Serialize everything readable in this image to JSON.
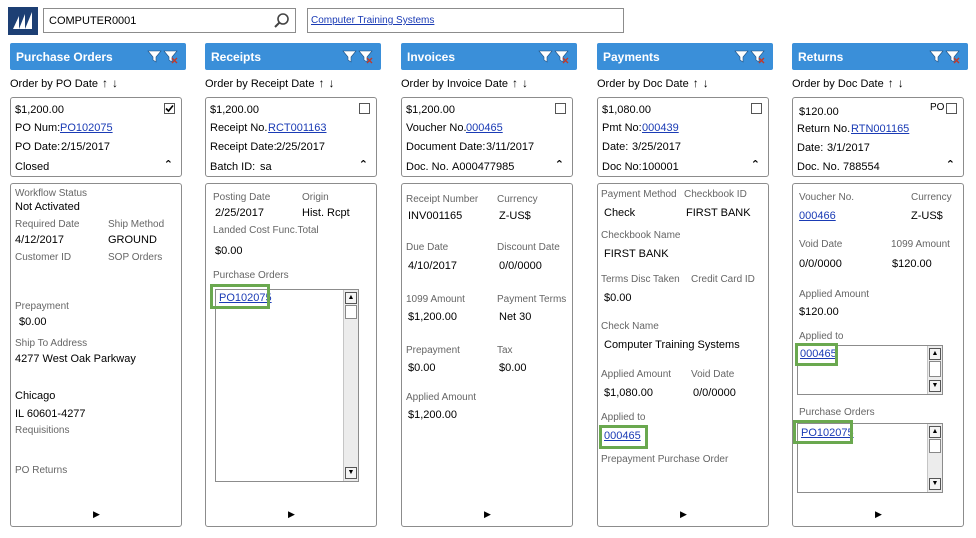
{
  "search": {
    "value": "COMPUTER0001"
  },
  "company": {
    "link": "Computer Training Systems"
  },
  "colors": {
    "header": "#3a8fd9",
    "highlight": "#6aa84f",
    "link": "#1a3bb5"
  },
  "columns": {
    "po": {
      "title": "Purchase Orders",
      "order_by": "Order by PO Date",
      "card": {
        "amount": "$1,200.00",
        "l1": "PO Num:",
        "v1": "PO102075",
        "l2": "PO Date:",
        "v2": "2/15/2017",
        "status": "Closed"
      },
      "detail": {
        "workflow_label": "Workflow Status",
        "workflow_value": "Not Activated",
        "req_date_label": "Required Date",
        "req_date_value": "4/12/2017",
        "ship_method_label": "Ship Method",
        "ship_method_value": "GROUND",
        "customer_id_label": "Customer ID",
        "sop_orders_label": "SOP Orders",
        "prepayment_label": "Prepayment",
        "prepayment_value": "$0.00",
        "ship_to_label": "Ship To Address",
        "address1": "4277 West Oak Parkway",
        "address2": "Chicago",
        "address3": "IL 60601-4277",
        "requisitions_label": "Requisitions",
        "po_returns_label": "PO Returns"
      }
    },
    "receipts": {
      "title": "Receipts",
      "order_by": "Order by Receipt Date",
      "card": {
        "amount": "$1,200.00",
        "l1": "Receipt No.",
        "v1": "RCT001163",
        "l2": "Receipt Date:",
        "v2": "2/25/2017",
        "l3": "Batch ID:",
        "v3": "sa"
      },
      "detail": {
        "posting_date_label": "Posting Date",
        "posting_date_value": "2/25/2017",
        "origin_label": "Origin",
        "origin_value": "Hist. Rcpt",
        "landed_label": "Landed Cost Func.Total",
        "landed_value": "$0.00",
        "po_label": "Purchase Orders",
        "po_link": "PO102075"
      }
    },
    "invoices": {
      "title": "Invoices",
      "order_by": "Order by Invoice Date",
      "card": {
        "amount": "$1,200.00",
        "l1": "Voucher No.",
        "v1": "000465",
        "l2": "Document Date:",
        "v2": "3/11/2017",
        "l3": "Doc. No.",
        "v3": "A000477985"
      },
      "detail": {
        "receipt_number_label": "Receipt Number",
        "receipt_number_value": "INV001165",
        "currency_label": "Currency",
        "currency_value": "Z-US$",
        "due_date_label": "Due Date",
        "due_date_value": "4/10/2017",
        "discount_date_label": "Discount Date",
        "discount_date_value": "0/0/0000",
        "amount_1099_label": "1099 Amount",
        "amount_1099_value": "$1,200.00",
        "payment_terms_label": "Payment Terms",
        "payment_terms_value": "Net 30",
        "prepayment_label": "Prepayment",
        "prepayment_value": "$0.00",
        "tax_label": "Tax",
        "tax_value": "$0.00",
        "applied_label": "Applied Amount",
        "applied_value": "$1,200.00"
      }
    },
    "payments": {
      "title": "Payments",
      "order_by": "Order by Doc Date",
      "card": {
        "amount": "$1,080.00",
        "l1": "Pmt No:",
        "v1": "000439",
        "l2": "Date:",
        "v2": "3/25/2017",
        "l3": "Doc No:",
        "v3": "100001"
      },
      "detail": {
        "method_label": "Payment Method",
        "method_value": "Check",
        "checkbook_id_label": "Checkbook ID",
        "checkbook_id_value": "FIRST BANK",
        "checkbook_name_label": "Checkbook Name",
        "checkbook_name_value": "FIRST BANK",
        "terms_label": "Terms Disc Taken",
        "terms_value": "$0.00",
        "credit_card_label": "Credit Card ID",
        "check_name_label": "Check Name",
        "check_name_value": "Computer Training Systems",
        "applied_amount_label": "Applied Amount",
        "applied_amount_value": "$1,080.00",
        "void_date_label": "Void Date",
        "void_date_value": "0/0/0000",
        "applied_to_label": "Applied to",
        "applied_to_link": "000465",
        "prepay_po_label": "Prepayment Purchase Order"
      }
    },
    "returns": {
      "title": "Returns",
      "order_by": "Order by Doc Date",
      "card": {
        "amount": "$120.00",
        "po_flag": "PO",
        "l1": "Return No.",
        "v1": "RTN001165",
        "l2": "Date:",
        "v2": "3/1/2017",
        "l3": "Doc. No.",
        "v3": "788554"
      },
      "detail": {
        "voucher_label": "Voucher No.",
        "voucher_link": "000466",
        "currency_label": "Currency",
        "currency_value": "Z-US$",
        "void_date_label": "Void Date",
        "void_date_value": "0/0/0000",
        "amount_1099_label": "1099 Amount",
        "amount_1099_value": "$120.00",
        "applied_amount_label": "Applied Amount",
        "applied_amount_value": "$120.00",
        "applied_to_label": "Applied to",
        "applied_to_link": "000465",
        "po_label": "Purchase Orders",
        "po_link": "PO102075"
      }
    }
  }
}
